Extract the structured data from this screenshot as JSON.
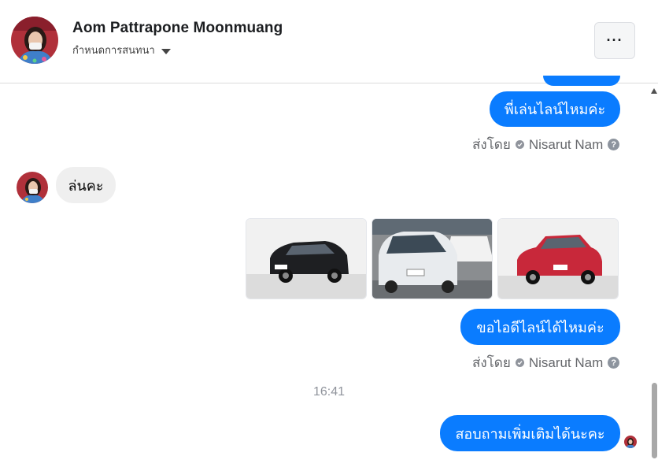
{
  "header": {
    "contact_name": "Aom Pattrapone Moonmuang",
    "subtitle": "กำหนดการสนทนา",
    "more_label": "···"
  },
  "messages": {
    "m1": "พี่เล่นไลน์ไหมค่ะ",
    "m1_sent_by_label": "ส่งโดย",
    "m1_sent_by_name": "Nisarut Nam",
    "m2": "ล่นคะ",
    "m3": "ขอไอดีไลน์ได้ไหมค่ะ",
    "m3_sent_by_label": "ส่งโดย",
    "m3_sent_by_name": "Nisarut Nam",
    "timestamp": "16:41",
    "m4": "สอบถามเพิ่มเติมได้นะคะ"
  },
  "photos": [
    {
      "name": "black hatchback",
      "color": "#1e1f22"
    },
    {
      "name": "white minivan",
      "color": "#e8ebee"
    },
    {
      "name": "red sedan",
      "color": "#c8283a"
    }
  ],
  "colors": {
    "outgoing_bubble": "#0a7cff",
    "incoming_bubble": "#efefef"
  },
  "help_glyph": "?"
}
